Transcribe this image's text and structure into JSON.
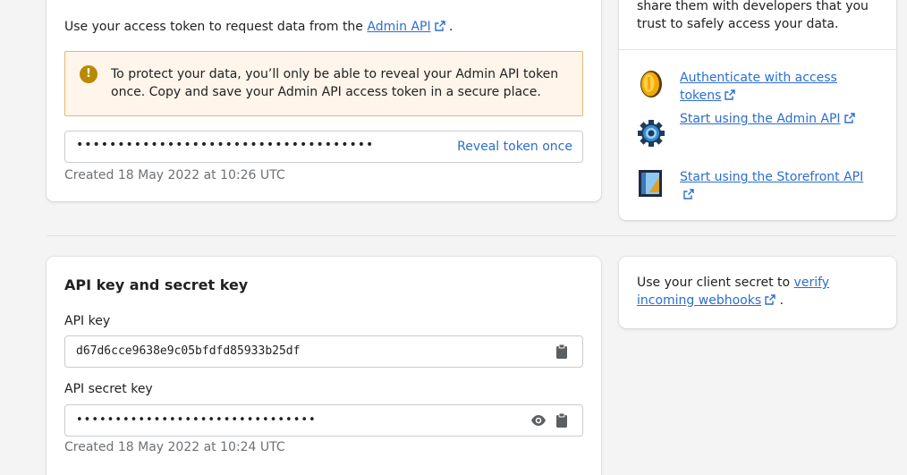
{
  "access_token": {
    "intro_text": "Use your access token to request data from the ",
    "intro_link": "Admin API",
    "intro_end": ".",
    "banner_text": "To protect your data, you’ll only be able to reveal your Admin API token once. Copy and save your Admin API access token in a secure place.",
    "token_masked": "••••••••••••••••••••••••••••••••••••",
    "reveal_label": "Reveal token once",
    "created": "Created 18 May 2022 at 10:26 UTC"
  },
  "sidebar_top": {
    "text": "share them with developers that you trust to safely access your data.",
    "resources": [
      {
        "label": "Authenticate with access tokens",
        "icon": "coin-icon"
      },
      {
        "label": "Start using the Admin API",
        "icon": "gear-icon"
      },
      {
        "label": "Start using the Storefront API",
        "icon": "storefront-icon"
      }
    ]
  },
  "api_keys": {
    "title": "API key and secret key",
    "api_key_label": "API key",
    "api_key_value": "d67d6cce9638e9c05bfdfd85933b25df",
    "secret_label": "API secret key",
    "secret_masked": "•••••••••••••••••••••••••••••••",
    "created": "Created 18 May 2022 at 10:24 UTC"
  },
  "sidebar_bottom": {
    "text": "Use your client secret to ",
    "link": "verify incoming webhooks",
    "end": "."
  },
  "colors": {
    "link": "#2c6ecb",
    "banner_bg": "#fff5ea",
    "banner_border": "#e1b878",
    "warning_icon": "#b98900"
  }
}
